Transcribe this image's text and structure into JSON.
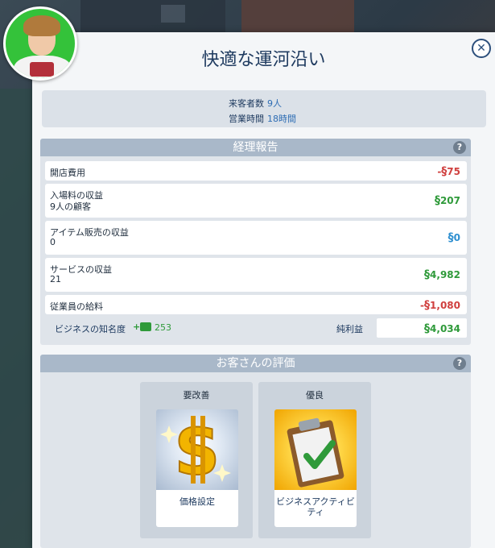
{
  "venue": {
    "title": "快適な運河沿い"
  },
  "info": {
    "visitors_label": "来客者数",
    "visitors_value": "9人",
    "hours_label": "営業時間",
    "hours_value": "18時間"
  },
  "report": {
    "header": "経理報告",
    "help": "?",
    "rows": [
      {
        "name": "開店費用",
        "sub": "",
        "sign": "-",
        "currency": "§",
        "amount": "75",
        "tone": "neg"
      },
      {
        "name": "入場料の収益",
        "sub": "9人の顧客",
        "sign": "",
        "currency": "§",
        "amount": "207",
        "tone": "pos"
      },
      {
        "name": "アイテム販売の収益",
        "sub": "0",
        "sign": "",
        "currency": "§",
        "amount": "0",
        "tone": "zero"
      },
      {
        "name": "サービスの収益",
        "sub": "21",
        "sign": "",
        "currency": "§",
        "amount": "4,982",
        "tone": "pos"
      },
      {
        "name": "従業員の給料",
        "sub": "",
        "sign": "-",
        "currency": "§",
        "amount": "1,080",
        "tone": "neg"
      }
    ],
    "fame_label": "ビジネスの知名度",
    "fame_plus": "+",
    "fame_value": "253",
    "net_label": "純利益",
    "net_currency": "§",
    "net_amount": "4,034"
  },
  "reviews": {
    "header": "お客さんの評価",
    "help": "?",
    "cards": [
      {
        "title": "要改善",
        "label": "価格設定",
        "icon": "simoleon-coin-icon"
      },
      {
        "title": "優良",
        "label": "ビジネスアクティビティ",
        "icon": "clipboard-checkmark-icon"
      }
    ]
  },
  "colors": {
    "positive": "#2f9a3a",
    "negative": "#d0403f",
    "neutral": "#2e8fd0",
    "title": "#1f3b60"
  }
}
